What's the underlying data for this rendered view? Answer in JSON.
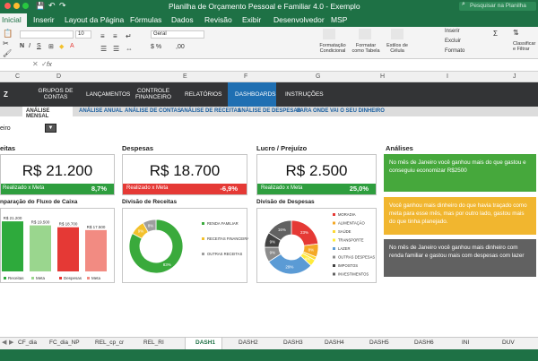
{
  "window": {
    "title": "Planilha de Orçamento Pessoal e Familiar 4.0 - Exemplo",
    "search_placeholder": "Pesquisar na Planilha"
  },
  "ribbon_tabs": [
    "Inicial",
    "Inserir",
    "Layout da Página",
    "Fórmulas",
    "Dados",
    "Revisão",
    "Exibir",
    "Desenvolvedor",
    "MSP"
  ],
  "ribbon": {
    "styles": [
      "Formatação Condicional",
      "Formatar como Tabela",
      "Estilos de Célula"
    ],
    "cells": [
      "Inserir",
      "Excluir",
      "Formato"
    ],
    "editing": "Classificar e Filtrar",
    "font_size": "10",
    "number_format": "Geral"
  },
  "formula_bar": {
    "fx": "fx"
  },
  "columns": [
    "C",
    "D",
    "E",
    "F",
    "G",
    "H",
    "I",
    "J"
  ],
  "nav": {
    "logo": "Z",
    "items": [
      "GRUPOS DE CONTAS",
      "LANÇAMENTOS",
      "CONTROLE FINANCEIRO",
      "RELATÓRIOS",
      "DASHBOARDS",
      "INSTRUÇÕES"
    ],
    "active": "DASHBOARDS"
  },
  "subnav": [
    "ANÁLISE MENSAL",
    "ANÁLISE ANUAL",
    "ANÁLISE DE CONTAS",
    "ANÁLISE DE RECEITAS",
    "ANÁLISE DE DESPESAS",
    "PARA ONDE VAI O SEU DINHEIRO"
  ],
  "month_select": "eiro",
  "kpis": [
    {
      "title": "eitas",
      "value": "R$ 21.200",
      "bar_label": "Realizado x Meta",
      "bar_value": "8,7%",
      "bar_color": "#2e9e3e"
    },
    {
      "title": "Despesas",
      "value": "R$ 18.700",
      "bar_label": "Realizado x Meta",
      "bar_value": "-6,9%",
      "bar_color": "#e53935"
    },
    {
      "title": "Lucro / Prejuízo",
      "value": "R$ 2.500",
      "bar_label": "Realizado x Meta",
      "bar_value": "25,0%",
      "bar_color": "#2e9e3e"
    }
  ],
  "analyses": {
    "title": "Análises",
    "items": [
      {
        "text": "No mês de Janeiro você ganhou mais do que gastou e conseguiu economizar R$2500",
        "color": "#46a83c"
      },
      {
        "text": "Você ganhou mais dinheiro do que havia traçado como meta para esse mês, mas por outro lado, gastou mais do que tinha planejado.",
        "color": "#f1b62f"
      },
      {
        "text": "No mês de Janeiro você ganhou mais dinheiro com renda familiar e gastou mais com despesas com lazer",
        "color": "#616161"
      }
    ]
  },
  "chart_data": [
    {
      "type": "bar",
      "title": "nparação do Fluxo de Caixa",
      "categories": [
        "Receitas",
        "Meta",
        "Despesas",
        "Meta"
      ],
      "values": [
        21200,
        19500,
        18700,
        17500
      ],
      "data_labels": [
        "R$ 21.200",
        "R$ 19.500",
        "R$ 18.700",
        "R$ 17.500"
      ],
      "colors": [
        "#2eaa3c",
        "#9ad68e",
        "#e53935",
        "#f28b82"
      ],
      "ylim": [
        0,
        22000
      ],
      "legend": "bottom"
    },
    {
      "type": "pie",
      "title": "Divisão de Receitas",
      "labels": [
        "RENDA FAMILIAR",
        "RECEITAS FINANCEIRAS",
        "OUTRAS RECEITAS"
      ],
      "values": [
        83,
        9,
        8
      ],
      "data_labels": [
        "83%",
        "9%",
        "8%"
      ],
      "colors": [
        "#3aaa3c",
        "#f3c12c",
        "#9e9e9e"
      ],
      "donut": true,
      "legend": "right"
    },
    {
      "type": "pie",
      "title": "Divisão de Despesas",
      "labels": [
        "MORADIA",
        "ALIMENTAÇÃO",
        "SAÚDE",
        "TRANSPORTE",
        "LAZER",
        "OUTRAS DESPESAS",
        "IMPOSTOS",
        "INVESTIMENTOS"
      ],
      "values": [
        23,
        8,
        2,
        4,
        29,
        9,
        9,
        16
      ],
      "data_labels": [
        "23%",
        "8%",
        "",
        "4%",
        "29%",
        "9%",
        "9%",
        "16%"
      ],
      "colors": [
        "#e53935",
        "#f4a826",
        "#fdd835",
        "#ffeb3b",
        "#5b9bd5",
        "#8c8c8c",
        "#424242",
        "#616161"
      ],
      "donut": true,
      "legend": "right"
    }
  ],
  "sheet_tabs": [
    "CF_dia",
    "FC_dia_NP",
    "REL_cp_cr",
    "REL_RI",
    "DASH1",
    "DASH2",
    "DASH3",
    "DASH4",
    "DASH5",
    "DASH6",
    "INI",
    "DUV"
  ],
  "active_sheet": "DASH1"
}
